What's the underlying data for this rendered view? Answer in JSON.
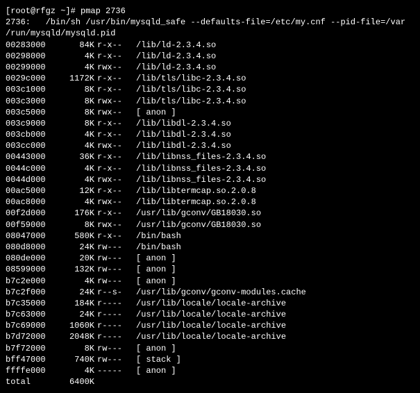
{
  "prompt": "[root@rfgz ~]# pmap 2736",
  "header1": "2736:   /bin/sh /usr/bin/mysqld_safe --defaults-file=/etc/my.cnf --pid-file=/var",
  "header2": "/run/mysqld/mysqld.pid",
  "rows": [
    {
      "addr": "00283000",
      "size": "84K",
      "perm": "r-x--",
      "path": "/lib/ld-2.3.4.so"
    },
    {
      "addr": "00298000",
      "size": "4K",
      "perm": "r-x--",
      "path": "/lib/ld-2.3.4.so"
    },
    {
      "addr": "00299000",
      "size": "4K",
      "perm": "rwx--",
      "path": "/lib/ld-2.3.4.so"
    },
    {
      "addr": "0029c000",
      "size": "1172K",
      "perm": "r-x--",
      "path": "/lib/tls/libc-2.3.4.so"
    },
    {
      "addr": "003c1000",
      "size": "8K",
      "perm": "r-x--",
      "path": "/lib/tls/libc-2.3.4.so"
    },
    {
      "addr": "003c3000",
      "size": "8K",
      "perm": "rwx--",
      "path": "/lib/tls/libc-2.3.4.so"
    },
    {
      "addr": "003c5000",
      "size": "8K",
      "perm": "rwx--",
      "path": "  [ anon ]"
    },
    {
      "addr": "003c9000",
      "size": "8K",
      "perm": "r-x--",
      "path": "/lib/libdl-2.3.4.so"
    },
    {
      "addr": "003cb000",
      "size": "4K",
      "perm": "r-x--",
      "path": "/lib/libdl-2.3.4.so"
    },
    {
      "addr": "003cc000",
      "size": "4K",
      "perm": "rwx--",
      "path": "/lib/libdl-2.3.4.so"
    },
    {
      "addr": "00443000",
      "size": "36K",
      "perm": "r-x--",
      "path": "/lib/libnss_files-2.3.4.so"
    },
    {
      "addr": "0044c000",
      "size": "4K",
      "perm": "r-x--",
      "path": "/lib/libnss_files-2.3.4.so"
    },
    {
      "addr": "0044d000",
      "size": "4K",
      "perm": "rwx--",
      "path": "/lib/libnss_files-2.3.4.so"
    },
    {
      "addr": "00ac5000",
      "size": "12K",
      "perm": "r-x--",
      "path": "/lib/libtermcap.so.2.0.8"
    },
    {
      "addr": "00ac8000",
      "size": "4K",
      "perm": "rwx--",
      "path": "/lib/libtermcap.so.2.0.8"
    },
    {
      "addr": "00f2d000",
      "size": "176K",
      "perm": "r-x--",
      "path": "/usr/lib/gconv/GB18030.so"
    },
    {
      "addr": "00f59000",
      "size": "8K",
      "perm": "rwx--",
      "path": "/usr/lib/gconv/GB18030.so"
    },
    {
      "addr": "08047000",
      "size": "580K",
      "perm": "r-x--",
      "path": "/bin/bash"
    },
    {
      "addr": "080d8000",
      "size": "24K",
      "perm": "rw---",
      "path": "/bin/bash"
    },
    {
      "addr": "080de000",
      "size": "20K",
      "perm": "rw---",
      "path": "  [ anon ]"
    },
    {
      "addr": "08599000",
      "size": "132K",
      "perm": "rw---",
      "path": "  [ anon ]"
    },
    {
      "addr": "b7c2e000",
      "size": "4K",
      "perm": "rw---",
      "path": "  [ anon ]"
    },
    {
      "addr": "b7c2f000",
      "size": "24K",
      "perm": "r--s-",
      "path": "/usr/lib/gconv/gconv-modules.cache"
    },
    {
      "addr": "b7c35000",
      "size": "184K",
      "perm": "r----",
      "path": "/usr/lib/locale/locale-archive"
    },
    {
      "addr": "b7c63000",
      "size": "24K",
      "perm": "r----",
      "path": "/usr/lib/locale/locale-archive"
    },
    {
      "addr": "b7c69000",
      "size": "1060K",
      "perm": "r----",
      "path": "/usr/lib/locale/locale-archive"
    },
    {
      "addr": "b7d72000",
      "size": "2048K",
      "perm": "r----",
      "path": "/usr/lib/locale/locale-archive"
    },
    {
      "addr": "b7f72000",
      "size": "8K",
      "perm": "rw---",
      "path": "  [ anon ]"
    },
    {
      "addr": "bff47000",
      "size": "740K",
      "perm": "rw---",
      "path": "  [ stack ]"
    },
    {
      "addr": "ffffe000",
      "size": "4K",
      "perm": "-----",
      "path": "  [ anon ]"
    }
  ],
  "total": {
    "label": " total",
    "value": "6400K"
  }
}
